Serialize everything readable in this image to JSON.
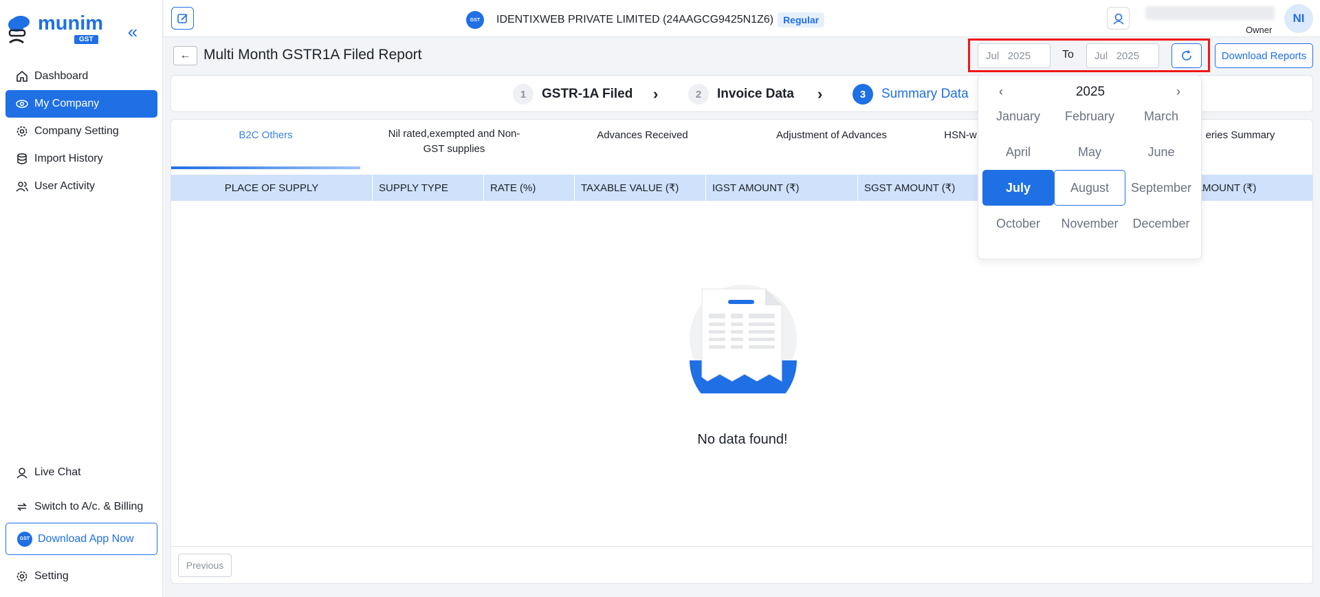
{
  "sidebar": {
    "logo_text": "munim",
    "logo_sub": "GST",
    "items": [
      {
        "label": "Dashboard",
        "icon": "home-icon"
      },
      {
        "label": "My Company",
        "icon": "eye-icon"
      },
      {
        "label": "Company Setting",
        "icon": "gear-icon"
      },
      {
        "label": "Import History",
        "icon": "database-icon"
      },
      {
        "label": "User Activity",
        "icon": "users-icon"
      }
    ],
    "live_chat": "Live Chat",
    "switch": "Switch to A/c. & Billing",
    "download_app": "Download App Now",
    "setting": "Setting"
  },
  "header": {
    "company": "IDENTIXWEB PRIVATE LIMITED (24AAGCG9425N1Z6)",
    "regular": "Regular",
    "role": "Owner",
    "avatar": "NI"
  },
  "page": {
    "title": "Multi Month GSTR1A Filed Report",
    "from_month": "Jul",
    "from_year": "2025",
    "to_label": "To",
    "to_month": "Jul",
    "to_year": "2025",
    "download": "Download Reports"
  },
  "steps": [
    {
      "num": "1",
      "label": "GSTR-1A Filed"
    },
    {
      "num": "2",
      "label": "Invoice Data"
    },
    {
      "num": "3",
      "label": "Summary Data"
    }
  ],
  "tabs": [
    "B2C Others",
    "Nil rated,exempted and Non-GST supplies",
    "Advances Received",
    "Adjustment of Advances",
    "HSN-w",
    "eries Summary"
  ],
  "columns": [
    "PLACE OF SUPPLY",
    "SUPPLY TYPE",
    "RATE (%)",
    "TAXABLE VALUE (₹)",
    "IGST AMOUNT (₹)",
    "SGST AMOUNT (₹)",
    "AMOUNT (₹)"
  ],
  "empty_text": "No data found!",
  "previous": "Previous",
  "picker": {
    "year": "2025",
    "prev": "‹",
    "next": "›",
    "months": [
      "January",
      "February",
      "March",
      "April",
      "May",
      "June",
      "July",
      "August",
      "September",
      "October",
      "November",
      "December"
    ],
    "selected": "July",
    "hovered": "August"
  },
  "colors": {
    "accent": "#1f6fe5",
    "highlight": "#f01616"
  }
}
